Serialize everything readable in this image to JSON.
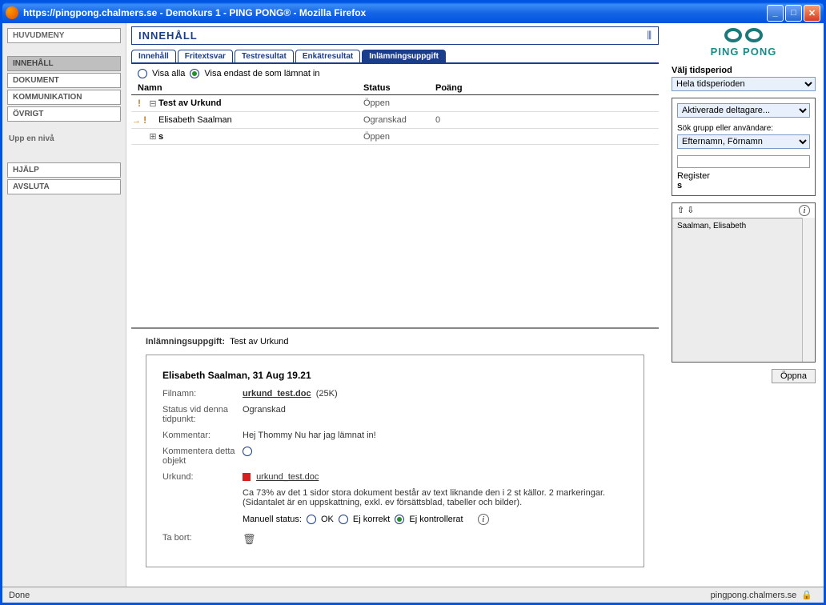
{
  "window": {
    "title": "https://pingpong.chalmers.se - Demokurs 1 - PING PONG® - Mozilla Firefox"
  },
  "sidebar": {
    "main_title": "HUVUDMENY",
    "items": [
      "INNEHÅLL",
      "DOKUMENT",
      "KOMMUNIKATION",
      "ÖVRIGT"
    ],
    "up_label": "Upp en nivå",
    "help": "HJÄLP",
    "quit": "AVSLUTA"
  },
  "page": {
    "title": "INNEHÅLL",
    "tabs": [
      "Innehåll",
      "Fritextsvar",
      "Testresultat",
      "Enkätresultat",
      "Inlämningsuppgift"
    ],
    "active_tab": 4
  },
  "filter": {
    "all": "Visa alla",
    "submitted": "Visa endast de som lämnat in"
  },
  "list": {
    "headers": {
      "name": "Namn",
      "status": "Status",
      "score": "Poäng"
    },
    "rows": [
      {
        "ind": "!",
        "tree": "⊟",
        "name": "Test av Urkund",
        "bold": true,
        "status": "Öppen",
        "score": ""
      },
      {
        "ind": "→ !",
        "tree": "",
        "name": "Elisabeth Saalman",
        "bold": false,
        "status": "Ogranskad",
        "score": "0"
      },
      {
        "ind": "",
        "tree": "⊞",
        "name": "s",
        "bold": true,
        "status": "Öppen",
        "score": ""
      }
    ]
  },
  "detail": {
    "section_label": "Inlämningsuppgift:",
    "section_value": "Test av Urkund",
    "heading": "Elisabeth Saalman, 31 Aug 19.21",
    "filename_label": "Filnamn:",
    "filename": "urkund_test.doc",
    "filesize": "(25K)",
    "status_label": "Status vid denna tidpunkt:",
    "status_value": "Ogranskad",
    "comment_label": "Kommentar:",
    "comment_value": "Hej Thommy Nu har jag lämnat in!",
    "comment_obj_label": "Kommentera detta objekt",
    "urkund_label": "Urkund:",
    "urkund_file": "urkund_test.doc",
    "urkund_text": "Ca 73% av det 1 sidor stora dokument består av text liknande den i 2 st källor. 2 markeringar. (Sidantalet är en uppskattning, exkl. ev försättsblad, tabeller och bilder).",
    "manual_label": "Manuell status:",
    "manual_opts": [
      "OK",
      "Ej korrekt",
      "Ej kontrollerat"
    ],
    "delete_label": "Ta bort:"
  },
  "right": {
    "logo_text": "PING PONG",
    "period_label": "Välj tidsperiod",
    "period_value": "Hela tidsperioden",
    "part_value": "Aktiverade deltagare...",
    "search_label": "Sök grupp eller användare:",
    "name_value": "Efternamn, Förnamn",
    "register_label": "Register",
    "register_value": "s",
    "list_item": "Saalman, Elisabeth",
    "open_btn": "Öppna"
  },
  "statusbar": {
    "left": "Done",
    "right": "pingpong.chalmers.se"
  }
}
